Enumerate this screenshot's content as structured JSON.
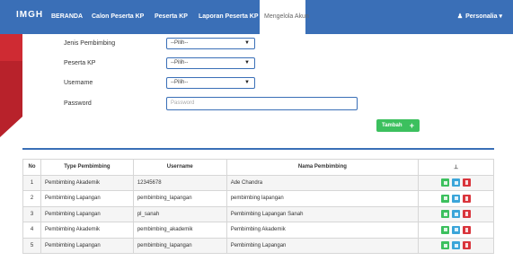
{
  "nav": {
    "brand": "IMGH",
    "items": [
      "BERANDA",
      "Calon Peserta KP",
      "Peserta KP",
      "Laporan Peserta KP",
      "Mengelola Akun"
    ],
    "user": "Personalia",
    "user_caret": "▾"
  },
  "form": {
    "jenis_label": "Jenis Pembimbing",
    "jenis_value": "--Pilih--",
    "peserta_label": "Peserta KP",
    "peserta_value": "--Pilih--",
    "username_label": "Username",
    "username_value": "--Pilih--",
    "password_label": "Password",
    "password_placeholder": "Password",
    "tambah_label": "Tambah",
    "tambah_icon": "+"
  },
  "table": {
    "headers": [
      "No",
      "Type Pembimbing",
      "Username",
      "Nama Pembimbing",
      "⊥"
    ],
    "rows": [
      [
        "1",
        "Pembimbing Akademik",
        "12345678",
        "Ade Chandra"
      ],
      [
        "2",
        "Pembimbing Lapangan",
        "pembimbing_lapangan",
        "pembimbing lapangan"
      ],
      [
        "3",
        "Pembimbing Lapangan",
        "pl_sanah",
        "Pembimbing Lapangan Sanah"
      ],
      [
        "4",
        "Pembimbing Akademik",
        "pembimbing_akademik",
        "Pembimbing Akademik"
      ],
      [
        "5",
        "Pembimbing Lapangan",
        "pembimbing_lapangan",
        "Pembimbing Lapangan"
      ]
    ]
  },
  "colors": {
    "nav_bg": "#3a6fb7",
    "accent_red": "#b8222b",
    "btn_green": "#3cc05e",
    "btn_blue": "#3ba5d9",
    "btn_red": "#d9343b"
  }
}
